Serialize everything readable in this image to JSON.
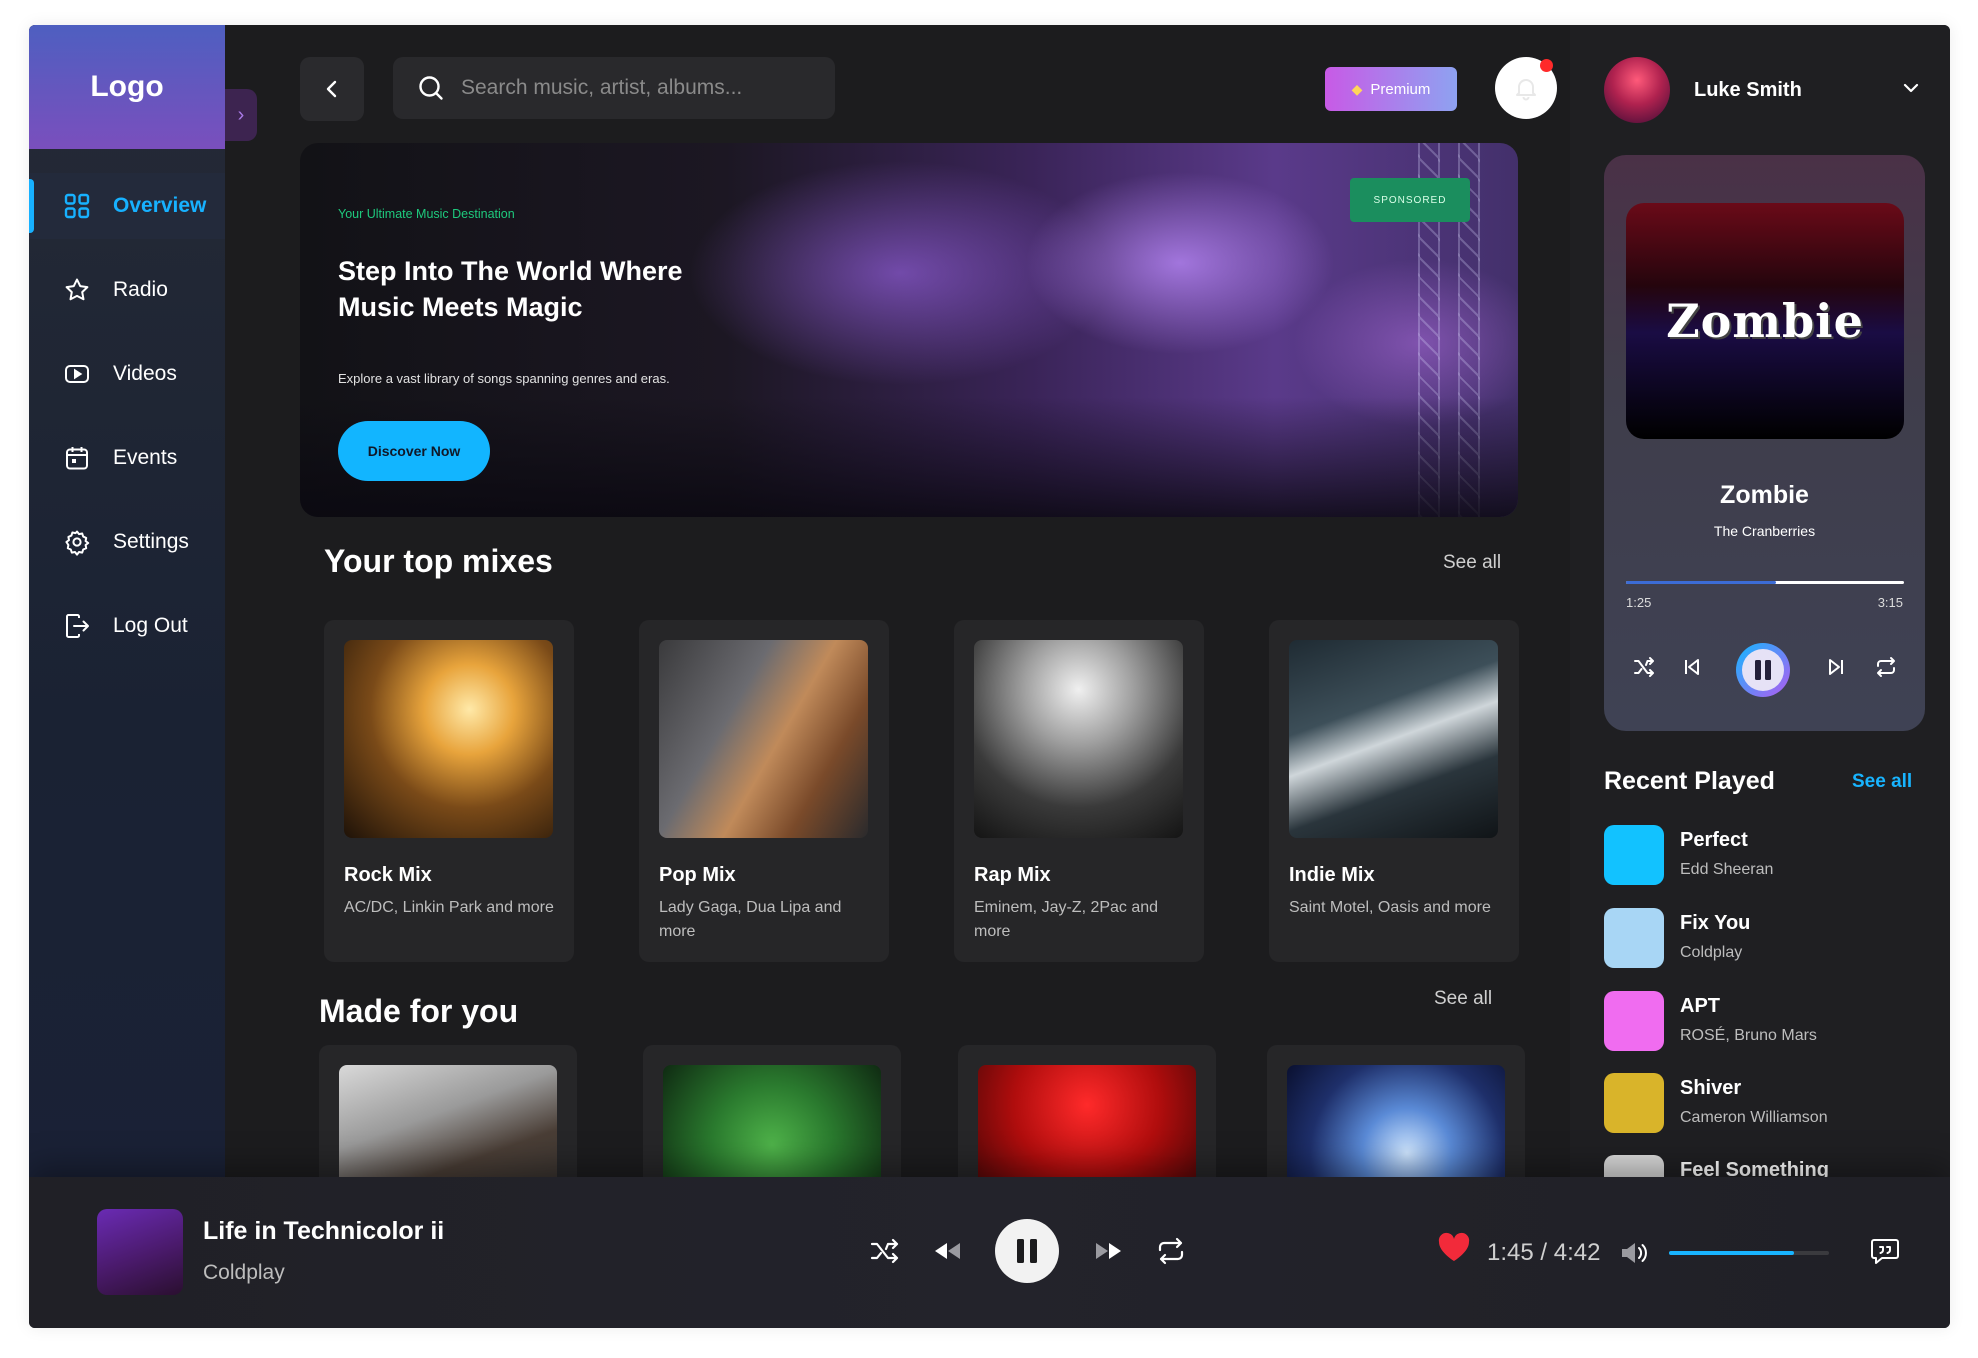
{
  "sidebar": {
    "logo": "Logo",
    "items": [
      {
        "label": "Overview",
        "icon": "grid-icon",
        "active": true
      },
      {
        "label": "Radio",
        "icon": "star-icon"
      },
      {
        "label": "Videos",
        "icon": "video-icon"
      },
      {
        "label": "Events",
        "icon": "calendar-icon"
      },
      {
        "label": "Settings",
        "icon": "gear-icon"
      },
      {
        "label": "Log Out",
        "icon": "logout-icon"
      }
    ]
  },
  "topbar": {
    "search_placeholder": "Search music, artist, albums...",
    "premium_label": "Premium"
  },
  "hero": {
    "eyebrow": "Your Ultimate Music Destination",
    "title": "Step Into The World Where Music Meets Magic",
    "subtitle": "Explore a vast library of songs spanning genres and eras.",
    "cta": "Discover Now",
    "badge": "SPONSORED"
  },
  "top_mixes": {
    "title": "Your top mixes",
    "see_all": "See all",
    "items": [
      {
        "name": "Rock Mix",
        "desc": "AC/DC, Linkin Park and more"
      },
      {
        "name": "Pop Mix",
        "desc": "Lady Gaga, Dua Lipa and more"
      },
      {
        "name": "Rap Mix",
        "desc": "Eminem, Jay-Z, 2Pac and more"
      },
      {
        "name": "Indie Mix",
        "desc": "Saint Motel, Oasis and more"
      }
    ]
  },
  "made_for_you": {
    "title": "Made for you",
    "see_all": "See all"
  },
  "profile": {
    "name": "Luke Smith"
  },
  "now_playing": {
    "cover_text": "Zombie",
    "title": "Zombie",
    "artist": "The Cranberries",
    "elapsed": "1:25",
    "duration": "3:15",
    "progress": 0.54
  },
  "recent": {
    "title": "Recent Played",
    "see_all": "See all",
    "items": [
      {
        "name": "Perfect",
        "artist": "Edd Sheeran",
        "color": "#12c2ff"
      },
      {
        "name": "Fix You",
        "artist": "Coldplay",
        "color": "#a8d6f5"
      },
      {
        "name": "APT",
        "artist": "ROSÉ, Bruno Mars",
        "color": "#f06cf0"
      },
      {
        "name": "Shiver",
        "artist": "Cameron Williamson",
        "color": "#d9b42a"
      },
      {
        "name": "Feel Something",
        "artist": "",
        "color": "#d9d9d9"
      }
    ]
  },
  "player": {
    "title": "Life in Technicolor ii",
    "artist": "Coldplay",
    "time": "1:45 / 4:42",
    "volume": 0.78
  },
  "colors": {
    "accent": "#18b4ff",
    "background": "#1c1c1e"
  }
}
